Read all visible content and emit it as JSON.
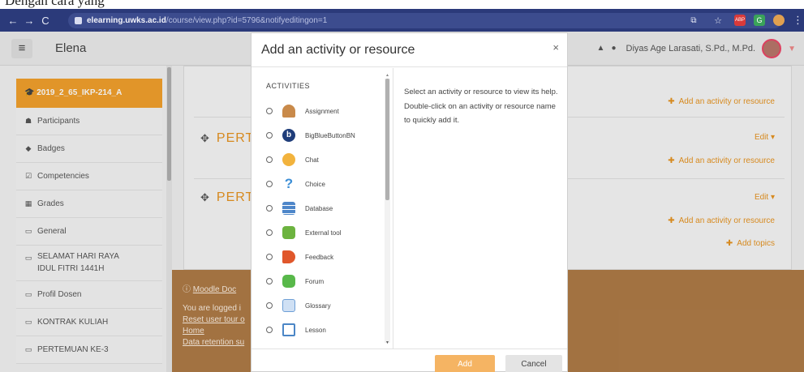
{
  "caption": "Dengan cara yang",
  "browser": {
    "url_host": "elearning.uwks.ac.id",
    "url_path": "/course/view.php?id=5796&notifyeditingon=1",
    "extensions": [
      "ABP",
      "G"
    ]
  },
  "navbar": {
    "site_name": "Elena",
    "user_name": "Diyas Age Larasati, S.Pd., M.Pd."
  },
  "sidebar": {
    "course": "2019_2_65_IKP-214_A",
    "items": [
      {
        "label": "Participants",
        "icon": "users-icon"
      },
      {
        "label": "Badges",
        "icon": "shield-icon"
      },
      {
        "label": "Competencies",
        "icon": "check-square-icon"
      },
      {
        "label": "Grades",
        "icon": "table-icon"
      },
      {
        "label": "General",
        "icon": "folder-icon"
      },
      {
        "label": "SELAMAT HARI RAYA IDUL FITRI 1441H",
        "icon": "folder-icon"
      },
      {
        "label": "Profil Dosen",
        "icon": "folder-icon"
      },
      {
        "label": "KONTRAK KULIAH",
        "icon": "folder-icon"
      },
      {
        "label": "PERTEMUAN KE-3",
        "icon": "folder-icon"
      }
    ]
  },
  "main": {
    "add_activity": "Add an activity or resource",
    "section_label": "PERT",
    "edit": "Edit",
    "add_topics": "Add topics",
    "footer": {
      "moodle_docs": "Moodle Doc",
      "logged_in": "You are logged i",
      "reset_tour": "Reset user tour o",
      "home": "Home",
      "data_retention": "Data retention su"
    }
  },
  "modal": {
    "title": "Add an activity or resource",
    "heading": "ACTIVITIES",
    "activities": [
      {
        "label": "Assignment",
        "icon": "assignment-icon",
        "color": "#c98a4a"
      },
      {
        "label": "BigBlueButtonBN",
        "icon": "bigbluebutton-icon",
        "color": "#1f3d7a"
      },
      {
        "label": "Chat",
        "icon": "chat-icon",
        "color": "#f2b33d"
      },
      {
        "label": "Choice",
        "icon": "question-icon",
        "color": "#3d8fd6"
      },
      {
        "label": "Database",
        "icon": "database-icon",
        "color": "#4d86c9"
      },
      {
        "label": "External tool",
        "icon": "puzzle-icon",
        "color": "#6cb33f"
      },
      {
        "label": "Feedback",
        "icon": "megaphone-icon",
        "color": "#e0572b"
      },
      {
        "label": "Forum",
        "icon": "forum-icon",
        "color": "#58b84a"
      },
      {
        "label": "Glossary",
        "icon": "glossary-icon",
        "color": "#6e9fd6"
      },
      {
        "label": "Lesson",
        "icon": "lesson-icon",
        "color": "#4b86c6"
      }
    ],
    "help_text": "Select an activity or resource to view its help. Double-click on an activity or resource name to quickly add it.",
    "add_button": "Add",
    "cancel_button": "Cancel"
  }
}
